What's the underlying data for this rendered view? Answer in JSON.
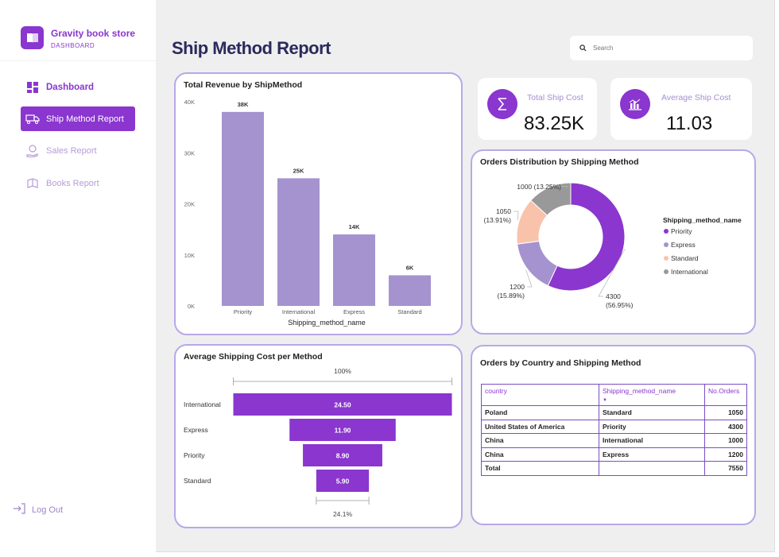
{
  "brand": {
    "title": "Gravity book store",
    "subtitle": "DASHBOARD"
  },
  "nav": [
    {
      "label": "Dashboard",
      "icon": "dashboard-icon"
    },
    {
      "label": "Ship Method Report",
      "icon": "truck-icon"
    },
    {
      "label": "Sales Report",
      "icon": "money-hand-icon"
    },
    {
      "label": "Books Report",
      "icon": "book-icon"
    }
  ],
  "logout": {
    "label": "Log Out"
  },
  "page": {
    "title": "Ship Method Report"
  },
  "search": {
    "placeholder": "Search"
  },
  "kpis": {
    "total_ship_cost": {
      "label": "Total Ship Cost",
      "value": "83.25K",
      "icon": "sigma-icon"
    },
    "avg_ship_cost": {
      "label": "Average Ship Cost",
      "value": "11.03",
      "icon": "bar-chart-icon"
    }
  },
  "colors": {
    "accent": "#8a36cf",
    "bar": "#a593cf",
    "border": "#b8a8e8",
    "priority": "#8a36cf",
    "express": "#a593cf",
    "standard": "#f9c2ab",
    "international": "#999999"
  },
  "chart_data": [
    {
      "type": "bar",
      "title": "Total Revenue by ShipMethod",
      "xlabel": "Shipping_method_name",
      "ylabel": "",
      "categories": [
        "Priority",
        "International",
        "Express",
        "Standard"
      ],
      "values": [
        38000,
        25000,
        14000,
        6000
      ],
      "data_labels": [
        "38K",
        "25K",
        "14K",
        "6K"
      ],
      "yticks": [
        "0K",
        "10K",
        "20K",
        "30K",
        "40K"
      ],
      "ylim": [
        0,
        40000
      ],
      "grid": false
    },
    {
      "type": "pie",
      "title": "Orders Distribution by Shipping Method",
      "legend_title": "Shipping_method_name",
      "legend_position": "right",
      "categories": [
        "Priority",
        "Express",
        "Standard",
        "International"
      ],
      "values": [
        4300,
        1200,
        1050,
        1000
      ],
      "data_labels": [
        [
          "4300",
          "(56.95%)"
        ],
        [
          "1200",
          "(15.89%)"
        ],
        [
          "1050",
          "(13.91%)"
        ],
        [
          "1000 (13.25%)"
        ]
      ]
    },
    {
      "type": "bar",
      "title": "Average Shipping Cost per Method",
      "categories": [
        "International",
        "Express",
        "Priority",
        "Standard"
      ],
      "values": [
        24.5,
        11.9,
        8.9,
        5.9
      ],
      "data_labels": [
        "24.50",
        "11.90",
        "8.90",
        "5.90"
      ],
      "top_label": "100%",
      "bottom_label": "24.1%"
    }
  ],
  "table": {
    "title": "Orders by Country and Shipping Method",
    "columns": [
      "country",
      "Shipping_method_name",
      "No.Orders"
    ],
    "rows": [
      [
        "Poland",
        "Standard",
        "1050"
      ],
      [
        "United States of America",
        "Priority",
        "4300"
      ],
      [
        "China",
        "International",
        "1000"
      ],
      [
        "China",
        "Express",
        "1200"
      ]
    ],
    "total": [
      "Total",
      "",
      "7550"
    ]
  }
}
